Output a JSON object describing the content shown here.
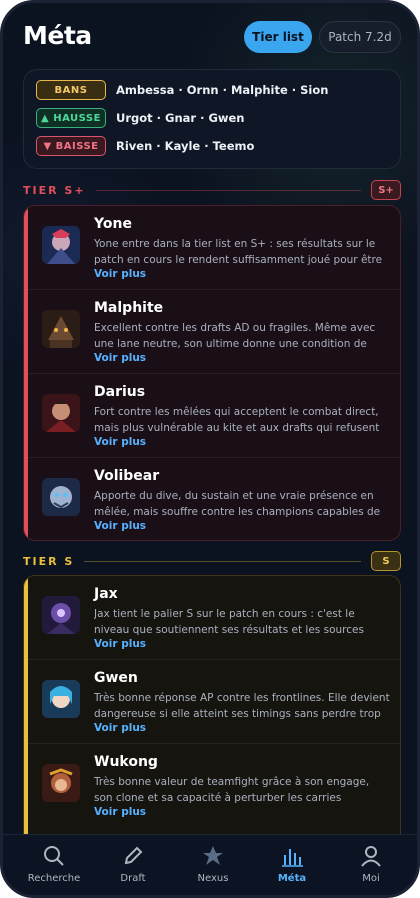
{
  "header": {
    "title": "Méta",
    "tier_list_button": "Tier list",
    "patch_button": "Patch 7.2d"
  },
  "trends": [
    {
      "badge": "BANS",
      "champions": "Ambessa · Ornn · Malphite · Sion"
    },
    {
      "badge": "▲ HAUSSE",
      "champions": "Urgot · Gnar · Gwen"
    },
    {
      "badge": "▼ BAISSE",
      "champions": "Riven · Kayle · Teemo"
    }
  ],
  "tiers": [
    {
      "label": "TIER S+",
      "chip": "S+",
      "color": "#e0505a",
      "champions": [
        {
          "name": "Yone",
          "desc": "Yone entre dans la tier list en S+ : ses résultats sur le patch en cours le rendent suffisamment joué pour être ...",
          "link": "Voir plus"
        },
        {
          "name": "Malphite",
          "desc": "Excellent contre les drafts AD ou fragiles. Même avec une lane neutre, son ultime donne une condition de fight trè...",
          "link": "Voir plus"
        },
        {
          "name": "Darius",
          "desc": "Fort contre les mêlées qui acceptent le combat direct, mais plus vulnérable au kite et aux drafts qui refusent ...",
          "link": "Voir plus"
        },
        {
          "name": "Volibear",
          "desc": "Apporte du dive, du sustain et une vraie présence en mêlée, mais souffre contre les champions capables de l...",
          "link": "Voir plus"
        }
      ]
    },
    {
      "label": "TIER S",
      "chip": "S",
      "color": "#e9bf3c",
      "champions": [
        {
          "name": "Jax",
          "desc": "Jax tient le palier S sur le patch en cours : c'est le niveau que soutiennent ses résultats et les sources externes ...",
          "link": "Voir plus"
        },
        {
          "name": "Gwen",
          "desc": "Très bonne réponse AP contre les frontlines. Elle devient dangereuse si elle atteint ses timings sans perdre trop ...",
          "link": "Voir plus"
        },
        {
          "name": "Wukong",
          "desc": "Très bonne valeur de teamfight grâce à son engage, son clone et sa capacité à perturber les carries adverses.",
          "link": "Voir plus"
        }
      ]
    }
  ],
  "tabs": [
    {
      "label": "Recherche",
      "icon": "search-icon"
    },
    {
      "label": "Draft",
      "icon": "pencil-icon"
    },
    {
      "label": "Nexus",
      "icon": "nexus-icon"
    },
    {
      "label": "Méta",
      "icon": "bar-chart-icon",
      "active": true
    },
    {
      "label": "Moi",
      "icon": "user-icon"
    }
  ]
}
